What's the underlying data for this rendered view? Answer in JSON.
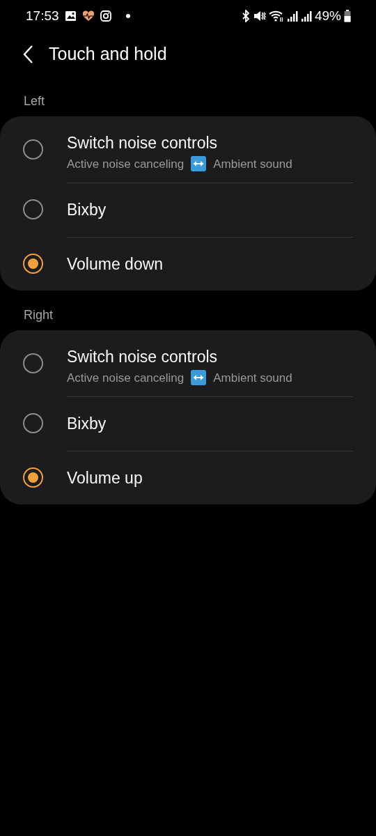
{
  "status_bar": {
    "time": "17:53",
    "battery_percent": "49%"
  },
  "title": "Touch and hold",
  "sections": [
    {
      "label": "Left",
      "options": [
        {
          "title": "Switch noise controls",
          "subtitle": [
            "Active noise canceling",
            "Ambient sound"
          ],
          "selected": false
        },
        {
          "title": "Bixby",
          "selected": false
        },
        {
          "title": "Volume down",
          "selected": true
        }
      ]
    },
    {
      "label": "Right",
      "options": [
        {
          "title": "Switch noise controls",
          "subtitle": [
            "Active noise canceling",
            "Ambient sound"
          ],
          "selected": false
        },
        {
          "title": "Bixby",
          "selected": false
        },
        {
          "title": "Volume up",
          "selected": true
        }
      ]
    }
  ]
}
